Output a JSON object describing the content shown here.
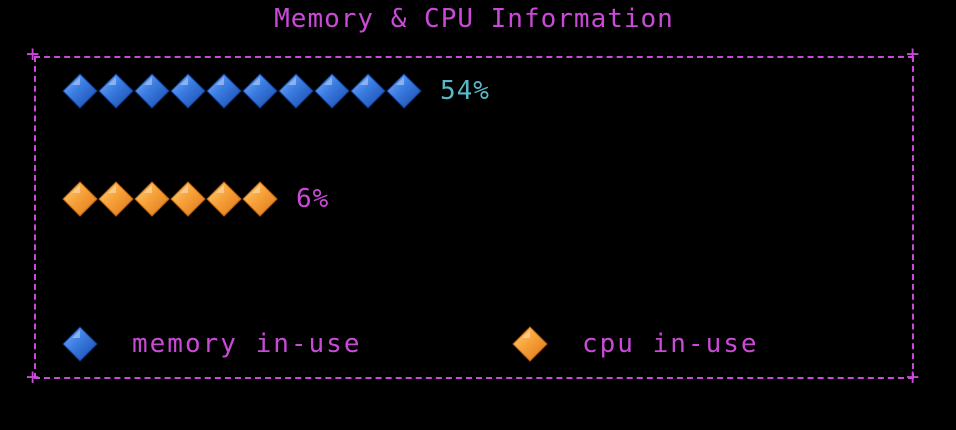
{
  "title": "Memory & CPU Information",
  "colors": {
    "border": "#c94ad6",
    "memory_gem": "#2f6fd8",
    "cpu_gem": "#f5a02e",
    "memory_pct_text": "#5ab8c8",
    "cpu_pct_text": "#c94ad6"
  },
  "memory": {
    "percent_label": "54%",
    "gem_count": 10,
    "icon": "blue-diamond-icon"
  },
  "cpu": {
    "percent_label": "6%",
    "gem_count": 6,
    "icon": "orange-diamond-icon"
  },
  "legend": {
    "memory_label": "memory in-use",
    "cpu_label": "cpu in-use"
  }
}
